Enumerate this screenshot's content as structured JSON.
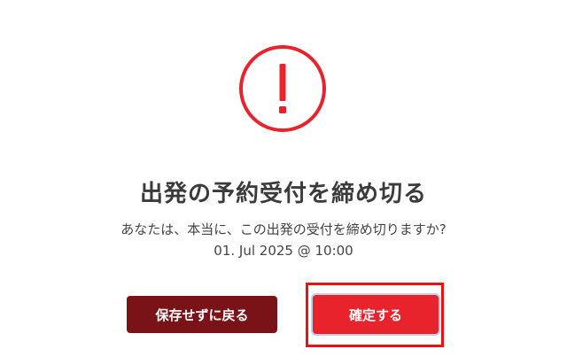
{
  "dialog": {
    "icon": "exclamation-circle-icon",
    "title": "出発の予約受付を締め切る",
    "message": "あなたは、本当に、この出発の受付を締め切りますか?",
    "datetime": "01. Jul 2025 @ 10:00",
    "cancel_label": "保存せずに戻る",
    "confirm_label": "確定する"
  },
  "colors": {
    "icon": "#e8232b",
    "cancel_button": "#7a1318",
    "confirm_button": "#e8232b",
    "highlight": "#ee1111"
  }
}
